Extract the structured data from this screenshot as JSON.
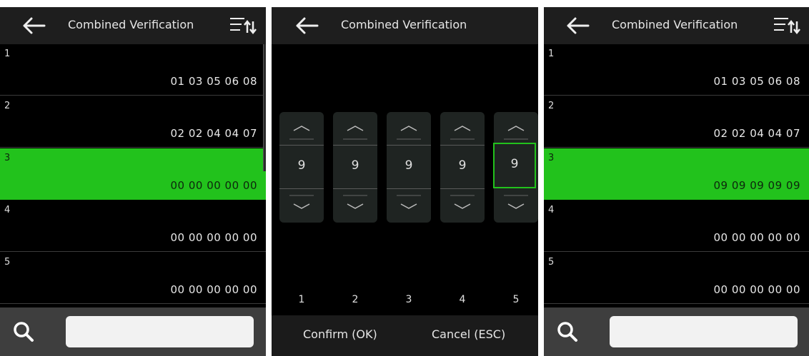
{
  "screens": [
    {
      "title": "Combined Verification",
      "rows": [
        {
          "index": "1",
          "value": "01 03 05 06 08"
        },
        {
          "index": "2",
          "value": "02 02 04 04 07"
        },
        {
          "index": "3",
          "value": "00 00 00 00 00"
        },
        {
          "index": "4",
          "value": "00 00 00 00 00"
        },
        {
          "index": "5",
          "value": "00 00 00 00 00"
        }
      ],
      "selected_row": "3",
      "search": {
        "value": "",
        "placeholder": ""
      }
    },
    {
      "title": "Combined Verification",
      "digits": [
        "9",
        "9",
        "9",
        "9",
        "9"
      ],
      "column_labels": [
        "1",
        "2",
        "3",
        "4",
        "5"
      ],
      "active_column": "5",
      "confirm_label": "Confirm (OK)",
      "cancel_label": "Cancel (ESC)"
    },
    {
      "title": "Combined Verification",
      "rows": [
        {
          "index": "1",
          "value": "01 03 05 06 08"
        },
        {
          "index": "2",
          "value": "02 02 04 04 07"
        },
        {
          "index": "3",
          "value": "09 09 09 09 09"
        },
        {
          "index": "4",
          "value": "00 00 00 00 00"
        },
        {
          "index": "5",
          "value": "00 00 00 00 00"
        }
      ],
      "selected_row": "3",
      "search": {
        "value": "",
        "placeholder": ""
      }
    }
  ],
  "icons": {
    "back": "back-arrow-icon",
    "sort": "sort-icon",
    "search": "search-icon",
    "up": "chevron-up-icon",
    "down": "chevron-down-icon"
  },
  "colors": {
    "selection": "#22c21c",
    "background": "#000000",
    "header": "#1e1e1e",
    "footer": "#3e3e3e"
  }
}
